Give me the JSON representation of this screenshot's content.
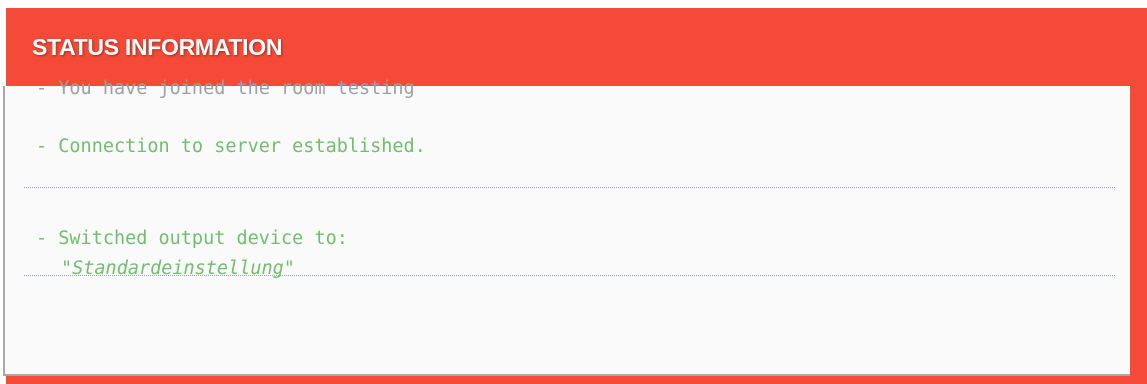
{
  "header": {
    "title": "STATUS INFORMATION"
  },
  "messages": [
    {
      "text": "- You have joined the room testing",
      "tone": "info"
    },
    {
      "text": "- Connection to server established.",
      "tone": "success"
    },
    {
      "text": "- Switched output device to:",
      "detail": "\"Standardeinstellung\"",
      "tone": "success"
    }
  ],
  "colors": {
    "header_bg": "#f44a37",
    "info_text": "#9aa0a6",
    "success_text": "#6fbf6c",
    "divider": "#8aa0b4"
  }
}
